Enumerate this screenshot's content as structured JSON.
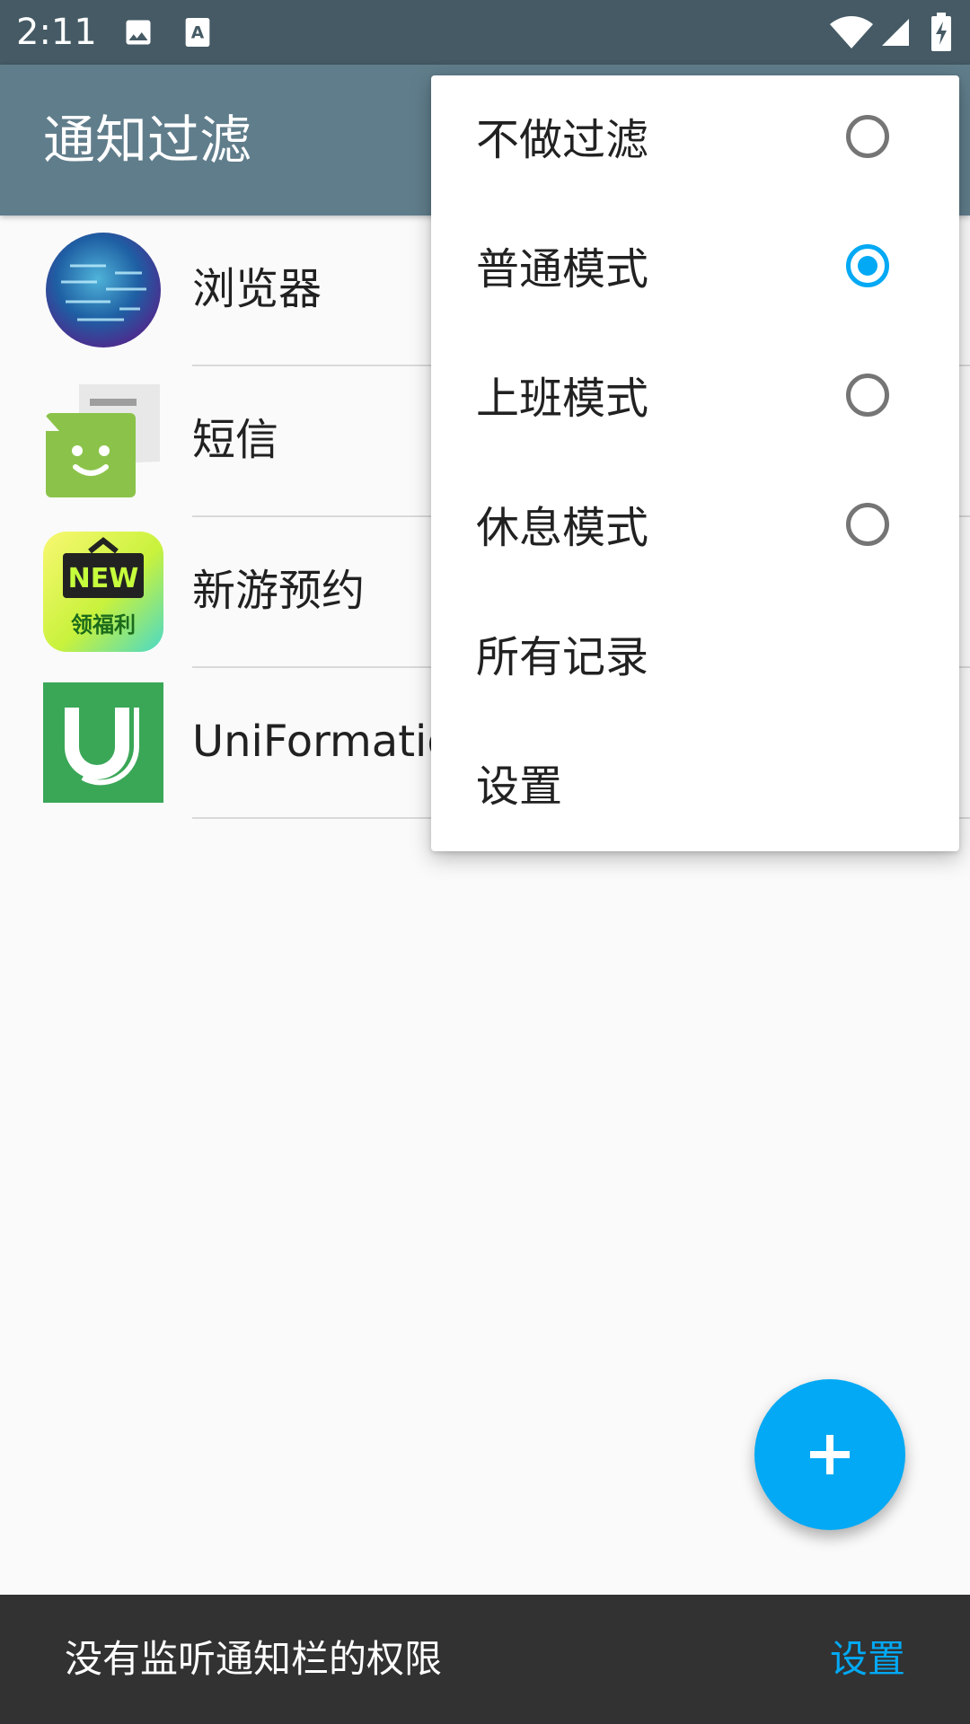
{
  "status_bar": {
    "time": "2:11",
    "icons": [
      "image-icon",
      "accessibility-a-icon",
      "wifi-icon",
      "signal-icon",
      "battery-charging-icon"
    ]
  },
  "app_bar": {
    "title": "通知过滤",
    "color": "#607d8b"
  },
  "apps": [
    {
      "label": "浏览器",
      "icon": "globe-browser-icon"
    },
    {
      "label": "短信",
      "icon": "sms-message-icon"
    },
    {
      "label": "新游预约",
      "icon": "new-game-icon",
      "badge_text": "NEW",
      "badge_subtext": "领福利"
    },
    {
      "label": "UniFormation",
      "icon": "uniformation-icon"
    }
  ],
  "menu": {
    "items": [
      {
        "label": "不做过滤",
        "type": "radio",
        "checked": false
      },
      {
        "label": "普通模式",
        "type": "radio",
        "checked": true
      },
      {
        "label": "上班模式",
        "type": "radio",
        "checked": false
      },
      {
        "label": "休息模式",
        "type": "radio",
        "checked": false
      },
      {
        "label": "所有记录",
        "type": "action"
      },
      {
        "label": "设置",
        "type": "action"
      }
    ],
    "accent": "#03a9f4"
  },
  "fab": {
    "icon": "plus-icon",
    "color": "#03a9f4"
  },
  "snackbar": {
    "message": "没有监听通知栏的权限",
    "action": "设置"
  }
}
